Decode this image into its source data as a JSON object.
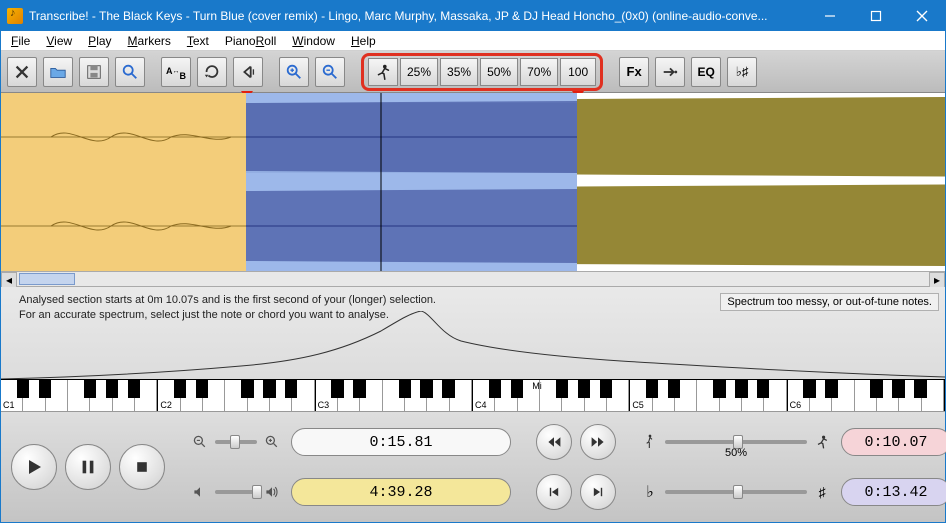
{
  "window": {
    "title": "Transcribe! - The Black Keys - Turn Blue (cover remix) - Lingo, Marc Murphy, Massaka, JP & DJ Head Honcho_(0x0) (online-audio-conve..."
  },
  "menu": {
    "items": [
      "File",
      "View",
      "Play",
      "Markers",
      "Text",
      "PianoRoll",
      "Window",
      "Help"
    ]
  },
  "toolbar": {
    "close": "close",
    "open": "open",
    "save": "save",
    "search": "search",
    "ab": "A↔B",
    "loop": "loop",
    "cue": "cue",
    "zoom_in": "zoom-in",
    "zoom_out": "zoom-out",
    "fx": "Fx",
    "misc": "→•",
    "eq": "EQ",
    "tuning": "♭♯"
  },
  "speed": {
    "options": [
      "25%",
      "35%",
      "50%",
      "70%",
      "100"
    ]
  },
  "spectrum": {
    "line1": "Analysed section starts at 0m 10.07s and is the first second of your (longer) selection.",
    "line2": "For an accurate spectrum, select just the note or chord you want to analyse.",
    "warning": "Spectrum too messy, or out-of-tune notes."
  },
  "piano": {
    "octaves": [
      "C1",
      "C2",
      "C3",
      "C4",
      "C5",
      "C6"
    ],
    "note_label": "Mi"
  },
  "transport": {
    "position": "0:15.81",
    "duration": "4:39.28",
    "sel_start": "0:10.07",
    "sel_end": "0:13.42",
    "speed_label": "50%"
  }
}
